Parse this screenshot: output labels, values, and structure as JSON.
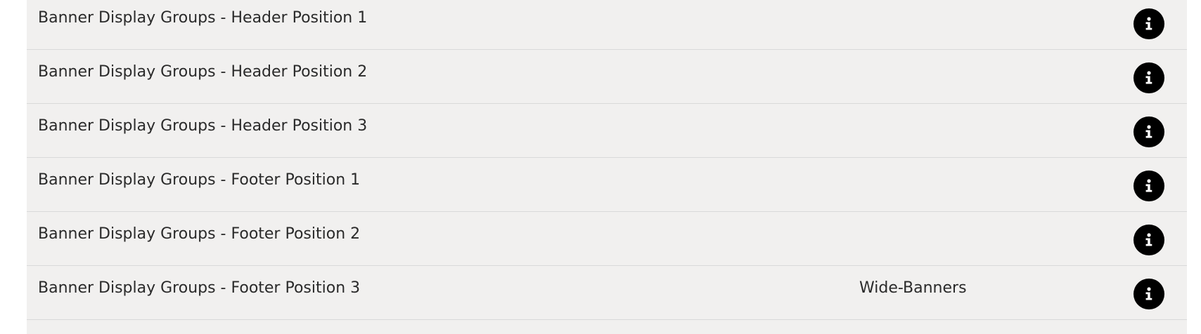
{
  "rows": [
    {
      "title": "Banner Display Groups - Header Position 1",
      "value": "",
      "icon": "info-icon"
    },
    {
      "title": "Banner Display Groups - Header Position 2",
      "value": "",
      "icon": "info-icon"
    },
    {
      "title": "Banner Display Groups - Header Position 3",
      "value": "",
      "icon": "info-icon"
    },
    {
      "title": "Banner Display Groups - Footer Position 1",
      "value": "",
      "icon": "info-icon"
    },
    {
      "title": "Banner Display Groups - Footer Position 2",
      "value": "",
      "icon": "info-icon"
    },
    {
      "title": "Banner Display Groups - Footer Position 3",
      "value": "Wide-Banners",
      "icon": "info-icon"
    }
  ],
  "colors": {
    "row_background": "#f1f0ef",
    "divider": "#d9d9d9",
    "icon_background": "#000000",
    "icon_glyph": "#ffffff",
    "text": "#2a2a2a"
  }
}
